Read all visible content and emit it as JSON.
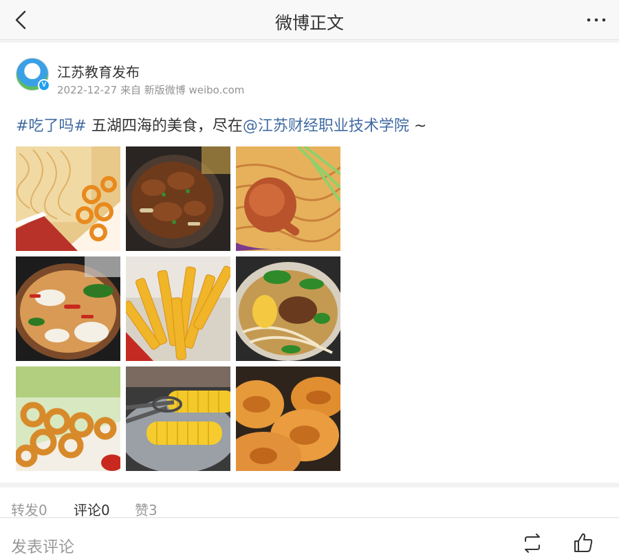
{
  "header": {
    "title": "微博正文",
    "back_icon": "chevron-left-icon",
    "more_icon": "more-dots-icon"
  },
  "post": {
    "author": "江苏教育发布",
    "avatar_badge": "V",
    "meta": "2022-12-27 来自 新版微博 weibo.com",
    "text": {
      "hashtag": "#吃了吗#",
      "body": " 五湖四海的美食，尽在",
      "mention": "@江苏财经职业技术学院",
      "tail": " ~"
    },
    "images": [
      {
        "subject": "dried noodles with onion rings and sauce"
      },
      {
        "subject": "braised meat in stone pot"
      },
      {
        "subject": "roast chicken leg on noodles"
      },
      {
        "subject": "spicy fish hot pot"
      },
      {
        "subject": "french fries"
      },
      {
        "subject": "noodle soup with greens"
      },
      {
        "subject": "fried onion rings"
      },
      {
        "subject": "steamed corn with tongs"
      },
      {
        "subject": "fried sesame cakes"
      }
    ]
  },
  "stats": {
    "repost": "转发0",
    "comment": "评论0",
    "like": "赞3"
  },
  "composer": {
    "placeholder": "发表评论",
    "repost_icon": "repost-icon",
    "like_icon": "thumbs-up-icon"
  },
  "colors": {
    "link": "#3f6aa1",
    "muted": "#999999",
    "text": "#333333"
  }
}
